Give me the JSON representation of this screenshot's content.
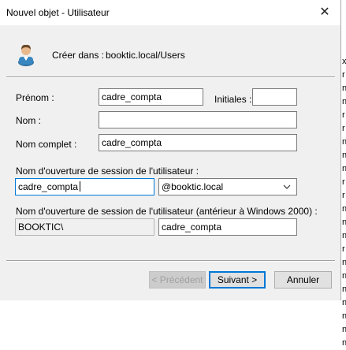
{
  "dialog": {
    "title": "Nouvel objet - Utilisateur",
    "close_glyph": "✕"
  },
  "header": {
    "icon": "user-icon",
    "create_in_label": "Créer dans :",
    "create_in_value": "booktic.local/Users"
  },
  "form": {
    "firstname_label": "Prénom :",
    "firstname_value": "cadre_compta",
    "initials_label": "Initiales :",
    "initials_value": "",
    "lastname_label": "Nom :",
    "lastname_value": "",
    "fullname_label": "Nom complet :",
    "fullname_value": "cadre_compta",
    "logon_label": "Nom d'ouverture de session de l'utilisateur :",
    "logon_value": "cadre_compta",
    "domain_value": "@booktic.local",
    "legacy_label": "Nom d'ouverture de session de l'utilisateur (antérieur à Windows 2000) :",
    "legacy_domain_value": "BOOKTIC\\",
    "legacy_logon_value": "cadre_compta"
  },
  "buttons": {
    "prev_label": "< Précédent",
    "next_label": "Suivant >",
    "cancel_label": "Annuler"
  },
  "background": {
    "chars": [
      "x",
      "r",
      "n",
      "n",
      "r",
      "r",
      "n",
      "n",
      "n",
      "r",
      "r",
      "n",
      "n",
      "n",
      "r",
      "n",
      "n",
      "n",
      "n",
      "n",
      "n",
      "n"
    ]
  },
  "colors": {
    "dialog_bg": "#f0f0f0",
    "focus_border": "#0078d7"
  }
}
